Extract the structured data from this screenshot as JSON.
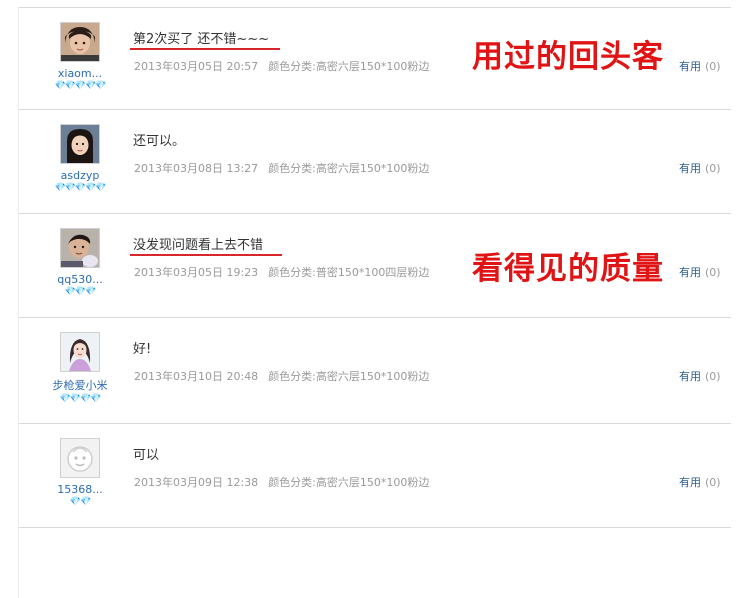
{
  "reviews": [
    {
      "username": "xiaom...",
      "hearts": "💎💎💎💎💎",
      "comment": "第2次买了 还不错~~~",
      "date": "2013年03月05日 20:57",
      "sku": "颜色分类:高密六层150*100粉边",
      "useful_label": "有用",
      "useful_count": "(0)"
    },
    {
      "username": "asdzyp",
      "hearts": "💎💎💎💎💎",
      "comment": "还可以。",
      "date": "2013年03月08日 13:27",
      "sku": "颜色分类:高密六层150*100粉边",
      "useful_label": "有用",
      "useful_count": "(0)"
    },
    {
      "username": "qq530...",
      "hearts": "💎💎💎",
      "comment": "没发现问题看上去不错",
      "date": "2013年03月05日 19:23",
      "sku": "颜色分类:普密150*100四层粉边",
      "useful_label": "有用",
      "useful_count": "(0)"
    },
    {
      "username": "步枪爱小米",
      "hearts": "💎💎💎💎",
      "comment": "好!",
      "date": "2013年03月10日 20:48",
      "sku": "颜色分类:高密六层150*100粉边",
      "useful_label": "有用",
      "useful_count": "(0)"
    },
    {
      "username": "15368...",
      "hearts": "💎💎",
      "comment": "可以",
      "date": "2013年03月09日 12:38",
      "sku": "颜色分类:高密六层150*100粉边",
      "useful_label": "有用",
      "useful_count": "(0)"
    }
  ],
  "stamps": {
    "first": "用过的回头客",
    "second": "看得见的质量"
  },
  "colors": {
    "accent_red": "#e01414",
    "username_blue": "#2b6cb0",
    "useful_blue": "#2d5f91",
    "meta_gray": "#9a9a9a",
    "divider": "#d9d9d9"
  }
}
